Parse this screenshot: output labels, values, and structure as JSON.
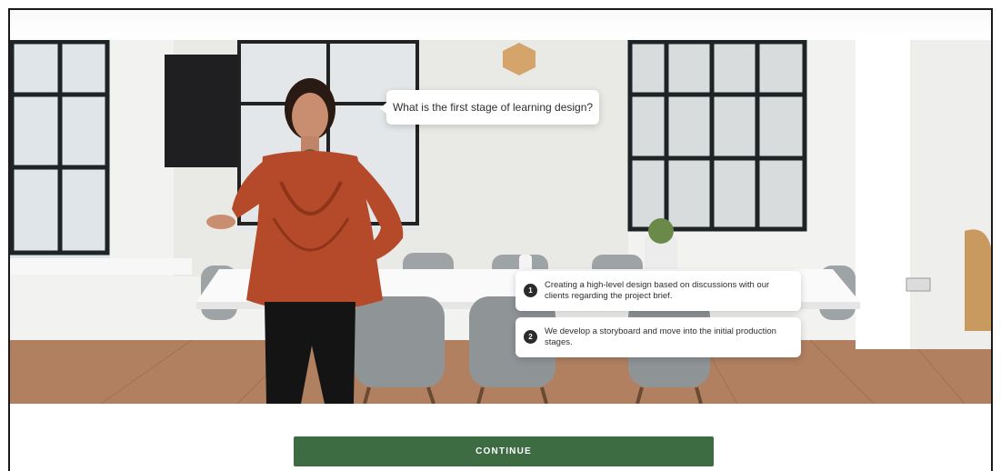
{
  "question": "What is the first stage of learning design?",
  "options": [
    {
      "number": "1",
      "text": "Creating a high-level design based on discussions with our clients regarding the project brief."
    },
    {
      "number": "2",
      "text": "We develop a storyboard and move into the initial production stages."
    }
  ],
  "continue_label": "CONTINUE",
  "colors": {
    "accent": "#3d6c43",
    "bubble_bg": "#ffffff",
    "badge": "#2b2b2b"
  }
}
